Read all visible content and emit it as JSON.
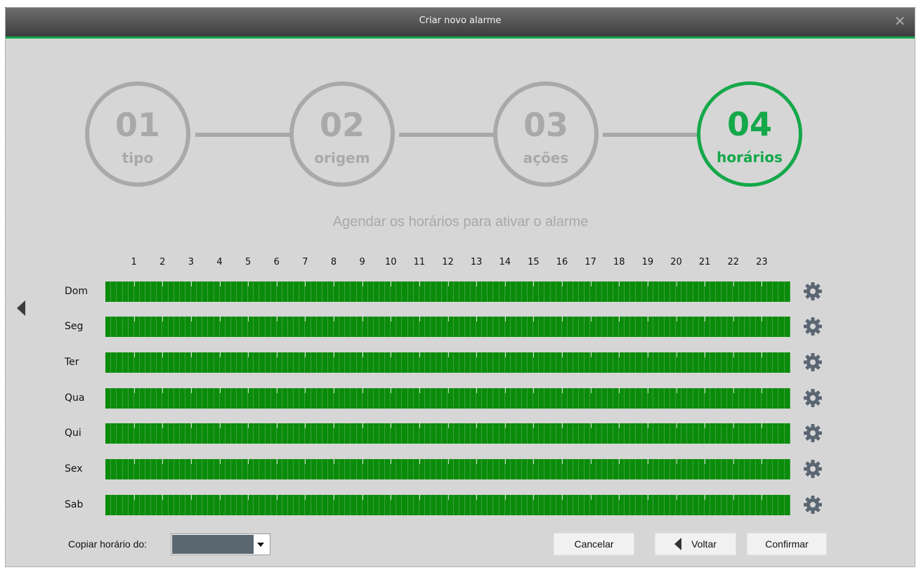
{
  "window": {
    "title": "Criar novo alarme",
    "close_icon": "close-icon"
  },
  "steps": [
    {
      "num": "01",
      "label": "tipo",
      "active": false
    },
    {
      "num": "02",
      "label": "origem",
      "active": false
    },
    {
      "num": "03",
      "label": "ações",
      "active": false
    },
    {
      "num": "04",
      "label": "horários",
      "active": true
    }
  ],
  "colors": {
    "accent": "#14a84a",
    "inactive_step": "#a9a9a9",
    "schedule_active": "#0a8c0a"
  },
  "schedule": {
    "subtitle": "Agendar os horários para ativar o alarme",
    "hours": [
      "1",
      "2",
      "3",
      "4",
      "5",
      "6",
      "7",
      "8",
      "9",
      "10",
      "11",
      "12",
      "13",
      "14",
      "15",
      "16",
      "17",
      "18",
      "19",
      "20",
      "21",
      "22",
      "23"
    ],
    "days": [
      "Dom",
      "Seg",
      "Ter",
      "Qua",
      "Qui",
      "Sex",
      "Sab"
    ],
    "day_icon": "gear-icon",
    "all_hours_enabled": true
  },
  "copy": {
    "label": "Copiar horário do:",
    "selected_value": ""
  },
  "buttons": {
    "cancel": "Cancelar",
    "back": "Voltar",
    "confirm": "Confirmar"
  }
}
